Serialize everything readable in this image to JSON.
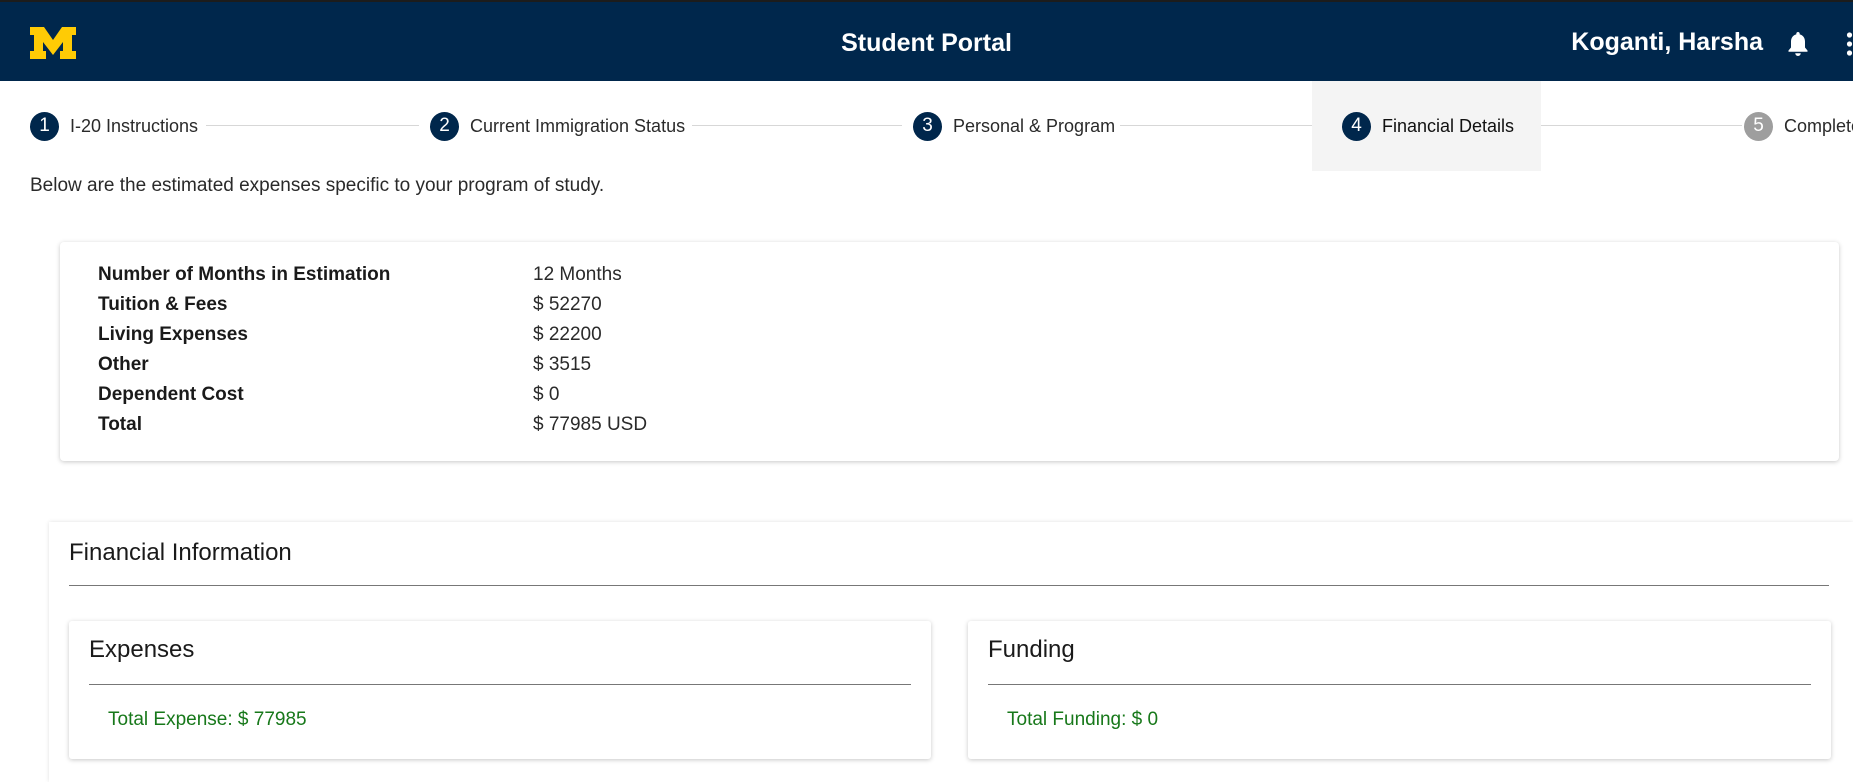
{
  "header": {
    "title": "Student Portal",
    "user_name": "Koganti, Harsha",
    "logo_icon": "block-m-logo",
    "notification_icon": "bell-icon",
    "menu_icon": "more-vert-icon",
    "colors": {
      "bar": "#00274c",
      "logo": "#ffcb05"
    }
  },
  "stepper": {
    "steps": [
      {
        "number": "1",
        "label": "I-20 Instructions"
      },
      {
        "number": "2",
        "label": "Current Immigration Status"
      },
      {
        "number": "3",
        "label": "Personal & Program"
      },
      {
        "number": "4",
        "label": "Financial Details"
      },
      {
        "number": "5",
        "label": "Complete"
      }
    ],
    "active_step": 4
  },
  "intro_text": "Below are the estimated expenses specific to your program of study.",
  "estimate": {
    "rows": [
      {
        "label": "Number of Months in Estimation",
        "value": "12 Months"
      },
      {
        "label": "Tuition & Fees",
        "value": "$ 52270"
      },
      {
        "label": "Living Expenses",
        "value": "$ 22200"
      },
      {
        "label": "Other",
        "value": "$ 3515"
      },
      {
        "label": "Dependent Cost",
        "value": "$ 0"
      },
      {
        "label": "Total",
        "value": "$ 77985 USD"
      }
    ]
  },
  "financial_info": {
    "title": "Financial Information",
    "expenses": {
      "title": "Expenses",
      "total": "Total Expense: $ 77985"
    },
    "funding": {
      "title": "Funding",
      "total": "Total Funding: $ 0"
    },
    "total_color": "#17781a"
  }
}
